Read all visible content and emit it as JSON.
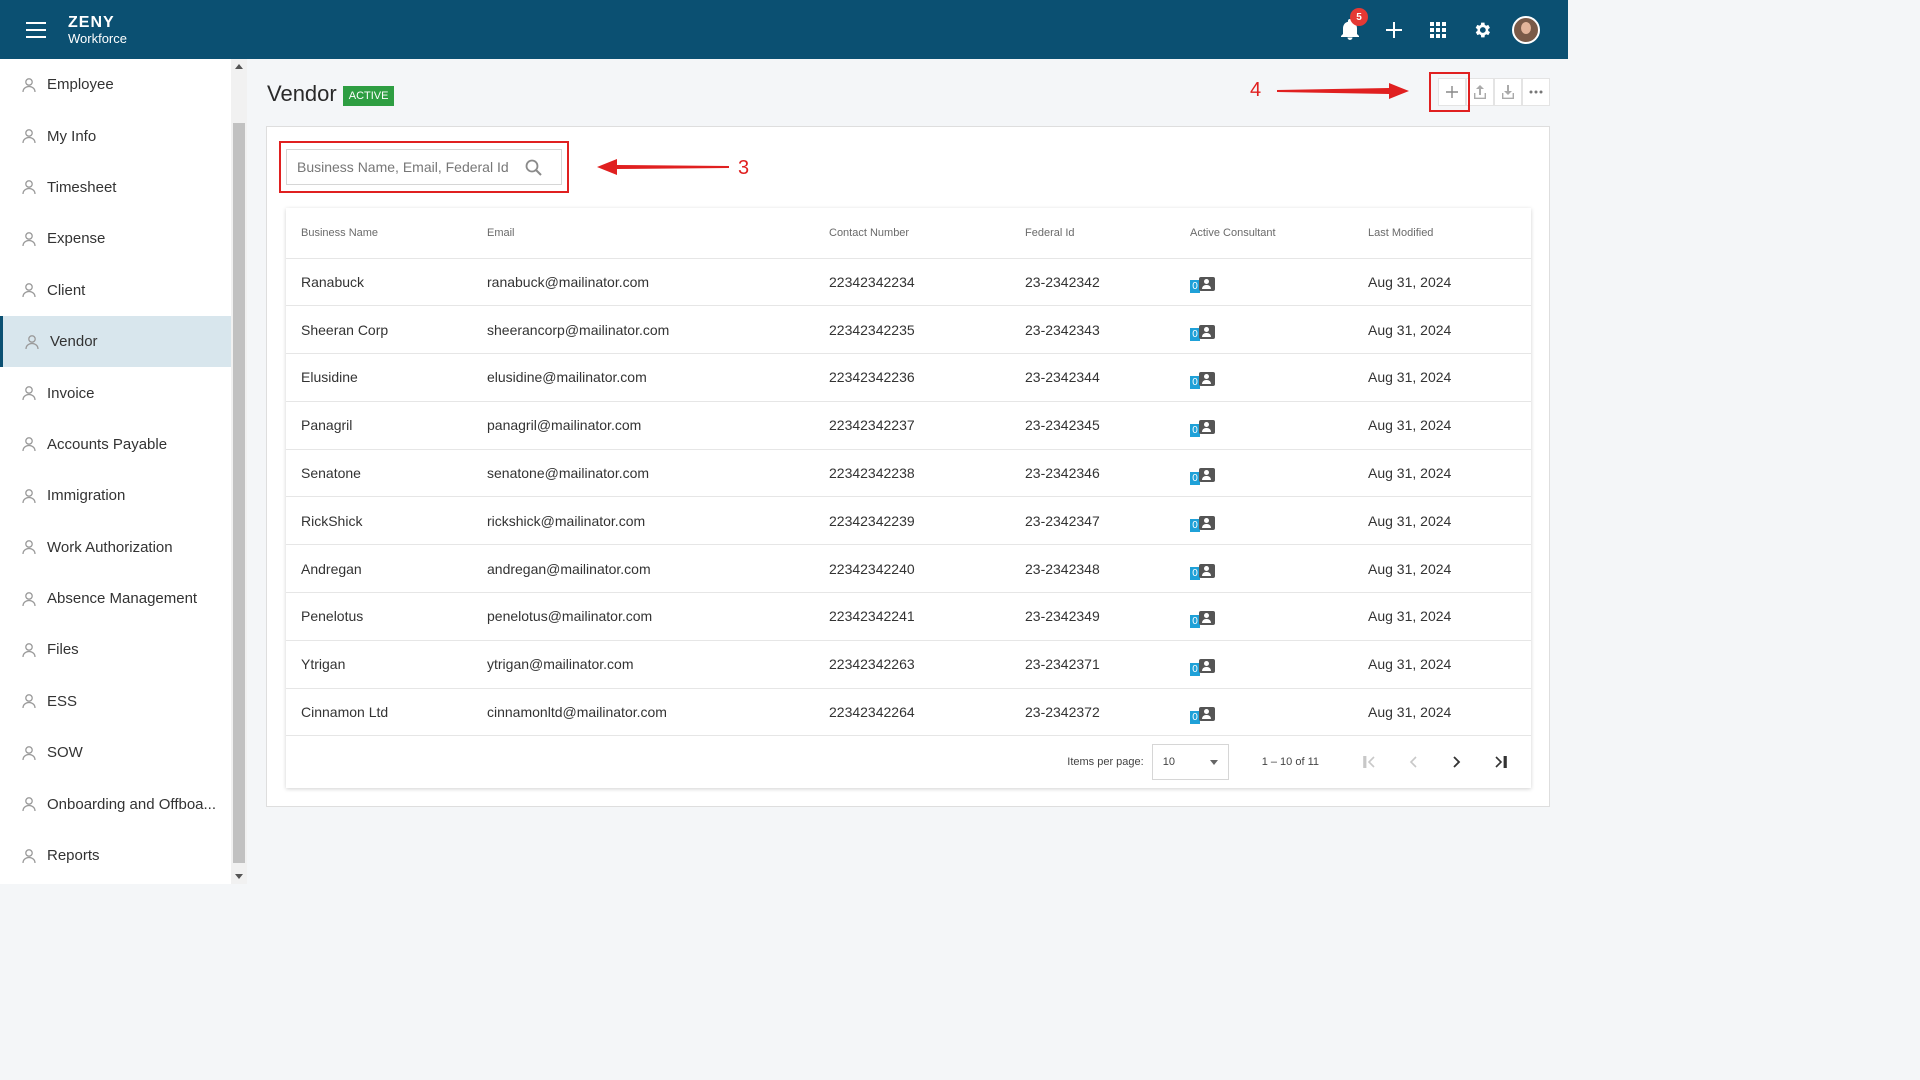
{
  "app": {
    "logo_main": "ZENY",
    "logo_sub": "Workforce"
  },
  "topbar": {
    "notifications_count": "5"
  },
  "sidebar": {
    "items": [
      {
        "label": "Employee",
        "icon": "employee-icon"
      },
      {
        "label": "My Info",
        "icon": "user-info-icon"
      },
      {
        "label": "Timesheet",
        "icon": "clock-icon"
      },
      {
        "label": "Expense",
        "icon": "expense-icon"
      },
      {
        "label": "Client",
        "icon": "client-icon"
      },
      {
        "label": "Vendor",
        "icon": "vendor-icon",
        "active": true
      },
      {
        "label": "Invoice",
        "icon": "invoice-icon"
      },
      {
        "label": "Accounts Payable",
        "icon": "accounts-payable-icon"
      },
      {
        "label": "Immigration",
        "icon": "immigration-icon"
      },
      {
        "label": "Work Authorization",
        "icon": "work-authorization-icon"
      },
      {
        "label": "Absence Management",
        "icon": "absence-icon"
      },
      {
        "label": "Files",
        "icon": "files-icon"
      },
      {
        "label": "ESS",
        "icon": "ess-icon"
      },
      {
        "label": "SOW",
        "icon": "sow-icon"
      },
      {
        "label": "Onboarding and Offboa...",
        "icon": "onboarding-icon"
      },
      {
        "label": "Reports",
        "icon": "reports-icon"
      }
    ]
  },
  "page": {
    "title": "Vendor",
    "status": "ACTIVE"
  },
  "annotations": {
    "search_marker": "3",
    "add_marker": "4"
  },
  "search": {
    "placeholder": "Business Name, Email, Federal Id",
    "value": ""
  },
  "table": {
    "columns": [
      "Business Name",
      "Email",
      "Contact Number",
      "Federal Id",
      "Active Consultant",
      "Last Modified"
    ],
    "rows": [
      {
        "name": "Ranabuck",
        "email": "ranabuck@mailinator.com",
        "phone": "22342342234",
        "fed": "23-2342342",
        "consultants": "0",
        "modified": "Aug 31, 2024"
      },
      {
        "name": "Sheeran Corp",
        "email": "sheerancorp@mailinator.com",
        "phone": "22342342235",
        "fed": "23-2342343",
        "consultants": "0",
        "modified": "Aug 31, 2024"
      },
      {
        "name": "Elusidine",
        "email": "elusidine@mailinator.com",
        "phone": "22342342236",
        "fed": "23-2342344",
        "consultants": "0",
        "modified": "Aug 31, 2024"
      },
      {
        "name": "Panagril",
        "email": "panagril@mailinator.com",
        "phone": "22342342237",
        "fed": "23-2342345",
        "consultants": "0",
        "modified": "Aug 31, 2024"
      },
      {
        "name": "Senatone",
        "email": "senatone@mailinator.com",
        "phone": "22342342238",
        "fed": "23-2342346",
        "consultants": "0",
        "modified": "Aug 31, 2024"
      },
      {
        "name": "RickShick",
        "email": "rickshick@mailinator.com",
        "phone": "22342342239",
        "fed": "23-2342347",
        "consultants": "0",
        "modified": "Aug 31, 2024"
      },
      {
        "name": "Andregan",
        "email": "andregan@mailinator.com",
        "phone": "22342342240",
        "fed": "23-2342348",
        "consultants": "0",
        "modified": "Aug 31, 2024"
      },
      {
        "name": "Penelotus",
        "email": "penelotus@mailinator.com",
        "phone": "22342342241",
        "fed": "23-2342349",
        "consultants": "0",
        "modified": "Aug 31, 2024"
      },
      {
        "name": "Ytrigan",
        "email": "ytrigan@mailinator.com",
        "phone": "22342342263",
        "fed": "23-2342371",
        "consultants": "0",
        "modified": "Aug 31, 2024"
      },
      {
        "name": "Cinnamon Ltd",
        "email": "cinnamonltd@mailinator.com",
        "phone": "22342342264",
        "fed": "23-2342372",
        "consultants": "0",
        "modified": "Aug 31, 2024"
      }
    ]
  },
  "pagination": {
    "label": "Items per page:",
    "per_page": "10",
    "range": "1 – 10 of 11"
  },
  "colors": {
    "topbar": "#0b5072",
    "active_badge": "#2e9e42",
    "annotation": "#e02020",
    "consultant_count": "#1fa1d8"
  }
}
